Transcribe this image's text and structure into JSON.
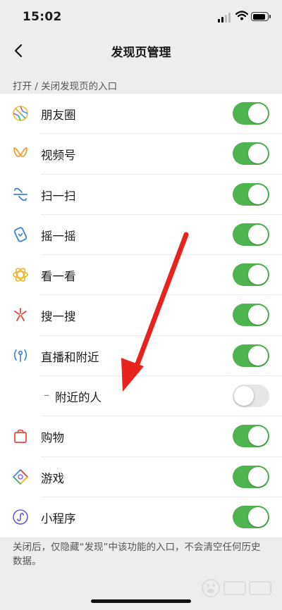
{
  "status_bar": {
    "time": "15:02"
  },
  "nav": {
    "title": "发现页管理"
  },
  "section_header": "打开 / 关闭发现页的入口",
  "items": [
    {
      "label": "朋友圈",
      "icon": "moments-icon",
      "on": true
    },
    {
      "label": "视频号",
      "icon": "channels-icon",
      "on": true
    },
    {
      "label": "扫一扫",
      "icon": "scan-icon",
      "on": true
    },
    {
      "label": "摇一摇",
      "icon": "shake-icon",
      "on": true
    },
    {
      "label": "看一看",
      "icon": "top-stories-icon",
      "on": true
    },
    {
      "label": "搜一搜",
      "icon": "search-icon",
      "on": true
    },
    {
      "label": "直播和附近",
      "icon": "live-nearby-icon",
      "on": true
    },
    {
      "label": "附近的人",
      "prefix": "–",
      "on": false
    },
    {
      "label": "购物",
      "icon": "shopping-bag-icon",
      "on": true
    },
    {
      "label": "游戏",
      "icon": "games-icon",
      "on": true
    },
    {
      "label": "小程序",
      "icon": "mini-programs-icon",
      "on": true
    }
  ],
  "footer_note": "关闭后，仅隐藏“发现”中该功能的入口，不会清空任何历史数据。",
  "colors": {
    "toggle_on": "#4fb34f",
    "toggle_off": "#e6e6e6",
    "arrow": "#e8231e"
  }
}
